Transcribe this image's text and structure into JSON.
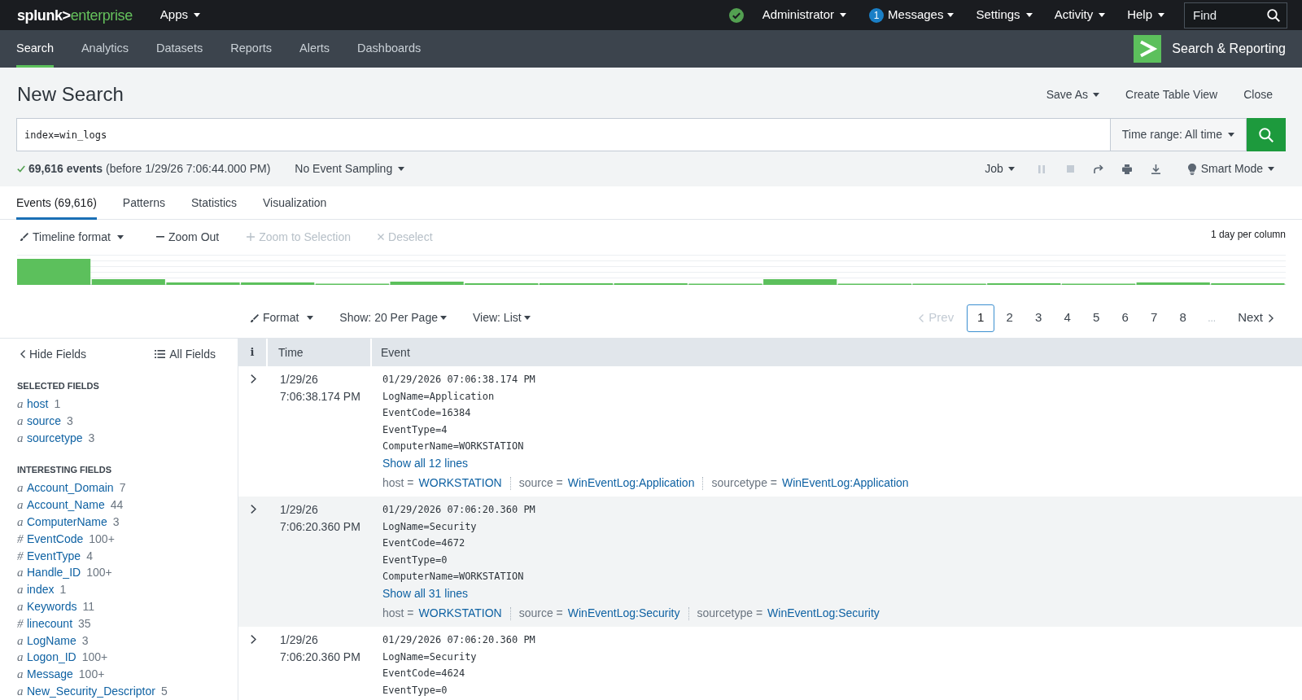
{
  "top_bar": {
    "logo": {
      "brand": "splunk>",
      "product": "enterprise"
    },
    "apps_menu": "Apps",
    "account_menu": "Administrator",
    "messages_menu": {
      "badge": "1",
      "label": "Messages"
    },
    "menus": [
      "Settings",
      "Activity",
      "Help"
    ],
    "find": {
      "placeholder": "Find"
    }
  },
  "app_bar": {
    "tabs": [
      {
        "label": "Search",
        "selected": true
      },
      {
        "label": "Analytics",
        "selected": false
      },
      {
        "label": "Datasets",
        "selected": false
      },
      {
        "label": "Reports",
        "selected": false
      },
      {
        "label": "Alerts",
        "selected": false
      },
      {
        "label": "Dashboards",
        "selected": false
      }
    ],
    "app_name": "Search & Reporting"
  },
  "header": {
    "title": "New Search",
    "actions": [
      {
        "label": "Save As",
        "dropdown": true
      },
      {
        "label": "Create Table View",
        "dropdown": false
      },
      {
        "label": "Close",
        "dropdown": false
      }
    ]
  },
  "search_bar": {
    "query": "index=win_logs",
    "time_range": "Time range: All time"
  },
  "job_status": {
    "summary": "**69,616 events** (before 1/29/26 7:06:44.000 PM)",
    "sampling": "No Event Sampling",
    "job_menu": "Job",
    "controls": [
      {
        "kind": "pause",
        "disabled": true
      },
      {
        "kind": "stop",
        "disabled": true
      },
      {
        "kind": "share",
        "disabled": false
      },
      {
        "kind": "print",
        "disabled": false
      },
      {
        "kind": "export",
        "disabled": false
      }
    ],
    "mode": "Smart Mode"
  },
  "result_tabs": [
    {
      "label": "Events (69,616)",
      "selected": true
    },
    {
      "label": "Patterns",
      "selected": false
    },
    {
      "label": "Statistics",
      "selected": false
    },
    {
      "label": "Visualization",
      "selected": false
    }
  ],
  "timeline": {
    "actions": [
      {
        "kind": "format",
        "label": "Timeline format",
        "disabled": false
      },
      {
        "kind": "zoom_out",
        "label": "Zoom Out",
        "disabled": false
      },
      {
        "kind": "zoom_in",
        "label": "Zoom to Selection",
        "disabled": true
      },
      {
        "kind": "deselect",
        "label": "Deselect",
        "disabled": true
      }
    ],
    "scale": "1 day per column"
  },
  "results_toolbar": {
    "format": "Format",
    "per_page": "Show: 20 Per Page",
    "view": "View: List",
    "pagination": {
      "prev": {
        "label": "Prev",
        "disabled": true
      },
      "pages": [
        {
          "label": "1",
          "selected": true
        },
        {
          "label": "2",
          "selected": false
        },
        {
          "label": "3",
          "selected": false
        },
        {
          "label": "4",
          "selected": false
        },
        {
          "label": "5",
          "selected": false
        },
        {
          "label": "6",
          "selected": false
        },
        {
          "label": "7",
          "selected": false
        },
        {
          "label": "8",
          "selected": false
        }
      ],
      "ellipsis": "...",
      "next": {
        "label": "Next",
        "disabled": false
      }
    }
  },
  "fields_sidebar": {
    "hide": "Hide Fields",
    "all": "All Fields",
    "sections": [
      {
        "title": "SELECTED FIELDS",
        "fields": [
          {
            "type": "a",
            "name": "host",
            "count": "1"
          },
          {
            "type": "a",
            "name": "source",
            "count": "3"
          },
          {
            "type": "a",
            "name": "sourcetype",
            "count": "3"
          }
        ]
      },
      {
        "title": "INTERESTING FIELDS",
        "fields": [
          {
            "type": "a",
            "name": "Account_Domain",
            "count": "7"
          },
          {
            "type": "a",
            "name": "Account_Name",
            "count": "44"
          },
          {
            "type": "a",
            "name": "ComputerName",
            "count": "3"
          },
          {
            "type": "#",
            "name": "EventCode",
            "count": "100+"
          },
          {
            "type": "#",
            "name": "EventType",
            "count": "4"
          },
          {
            "type": "a",
            "name": "Handle_ID",
            "count": "100+"
          },
          {
            "type": "a",
            "name": "index",
            "count": "1"
          },
          {
            "type": "a",
            "name": "Keywords",
            "count": "11"
          },
          {
            "type": "#",
            "name": "linecount",
            "count": "35"
          },
          {
            "type": "a",
            "name": "LogName",
            "count": "3"
          },
          {
            "type": "a",
            "name": "Logon_ID",
            "count": "100+"
          },
          {
            "type": "a",
            "name": "Message",
            "count": "100+"
          },
          {
            "type": "a",
            "name": "New_Security_Descriptor",
            "count": "5"
          }
        ]
      }
    ]
  },
  "events_table": {
    "columns": [
      "i",
      "Time",
      "Event"
    ],
    "rows": [
      {
        "expanded": false,
        "time": "1/29/26 7:06:38.174 PM",
        "lines": [
          "01/29/2026 07:06:38.174 PM",
          "LogName=Application",
          "EventCode=16384",
          "EventType=4",
          "ComputerName=WORKSTATION"
        ],
        "show_all": "Show all 12 lines",
        "fields": [
          {
            "key": "host =",
            "value": "WORKSTATION"
          },
          {
            "key": "source =",
            "value": "WinEventLog:Application"
          },
          {
            "key": "sourcetype =",
            "value": "WinEventLog:Application"
          }
        ]
      },
      {
        "expanded": false,
        "time": "1/29/26 7:06:20.360 PM",
        "lines": [
          "01/29/2026 07:06:20.360 PM",
          "LogName=Security",
          "EventCode=4672",
          "EventType=0",
          "ComputerName=WORKSTATION"
        ],
        "show_all": "Show all 31 lines",
        "fields": [
          {
            "key": "host =",
            "value": "WORKSTATION"
          },
          {
            "key": "source =",
            "value": "WinEventLog:Security"
          },
          {
            "key": "sourcetype =",
            "value": "WinEventLog:Security"
          }
        ]
      },
      {
        "expanded": false,
        "time": "1/29/26 7:06:20.360 PM",
        "lines": [
          "01/29/2026 07:06:20.360 PM",
          "LogName=Security",
          "EventCode=4624",
          "EventType=0"
        ]
      }
    ]
  }
}
